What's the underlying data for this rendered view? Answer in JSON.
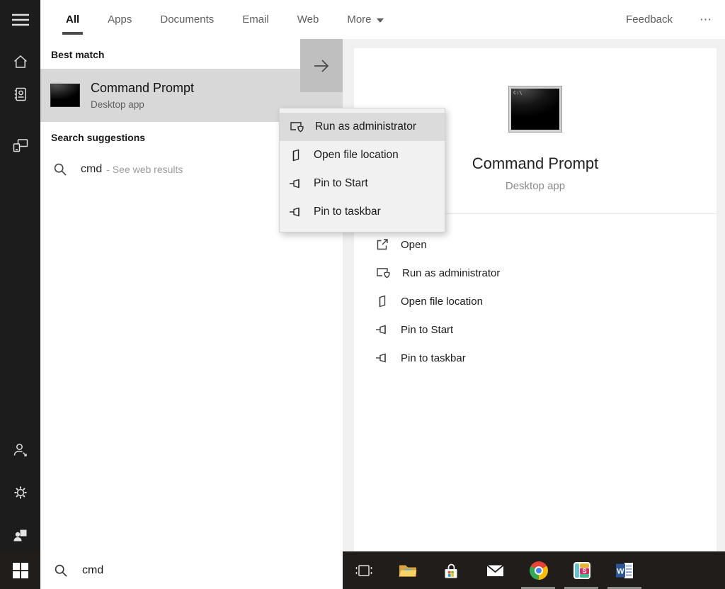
{
  "topbar": {
    "tabs": [
      {
        "label": "All",
        "active": true
      },
      {
        "label": "Apps",
        "active": false
      },
      {
        "label": "Documents",
        "active": false
      },
      {
        "label": "Email",
        "active": false
      },
      {
        "label": "Web",
        "active": false
      }
    ],
    "more_label": "More",
    "feedback_label": "Feedback",
    "overflow_label": "⋯"
  },
  "best_match": {
    "header": "Best match",
    "title": "Command Prompt",
    "subtitle": "Desktop app"
  },
  "suggestions": {
    "header": "Search suggestions",
    "query": "cmd",
    "hint": "- See web results"
  },
  "context_menu": {
    "items": [
      {
        "label": "Run as administrator",
        "icon": "run-as-admin-icon",
        "highlighted": true
      },
      {
        "label": "Open file location",
        "icon": "file-location-icon",
        "highlighted": false
      },
      {
        "label": "Pin to Start",
        "icon": "pin-icon",
        "highlighted": false
      },
      {
        "label": "Pin to taskbar",
        "icon": "pin-icon",
        "highlighted": false
      }
    ]
  },
  "preview": {
    "title": "Command Prompt",
    "subtitle": "Desktop app",
    "actions": [
      {
        "label": "Open",
        "icon": "open-icon"
      },
      {
        "label": "Run as administrator",
        "icon": "run-as-admin-icon"
      },
      {
        "label": "Open file location",
        "icon": "file-location-icon"
      },
      {
        "label": "Pin to Start",
        "icon": "pin-icon"
      },
      {
        "label": "Pin to taskbar",
        "icon": "pin-icon"
      }
    ]
  },
  "taskbar": {
    "search_value": "cmd",
    "apps": [
      "task-view",
      "file-explorer",
      "store",
      "mail",
      "chrome",
      "slack",
      "word"
    ],
    "running_apps": [
      "chrome",
      "slack",
      "word"
    ],
    "word_letter": "W",
    "slack_letter": "S"
  },
  "colors": {
    "best_match_highlight": "#d8d8d8",
    "arrow_button": "#bfbfbf",
    "menu_highlight": "#dbdbdb",
    "right_panel_bg": "#f0f0f0",
    "sidebar_bg": "#1c1c1c",
    "taskbar_bg": "#201d1b"
  }
}
